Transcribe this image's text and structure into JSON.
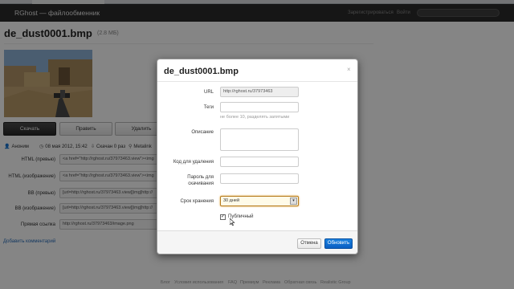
{
  "navbar": {
    "brand": "RGhost — файлообменник",
    "register": "Зарегистрироваться",
    "login": "Войти"
  },
  "file": {
    "title": "de_dust0001.bmp",
    "size": "(2.8 МБ)",
    "buttons": {
      "download": "Скачать",
      "edit": "Править",
      "delete": "Удалить"
    },
    "meta": {
      "author": "Аноним",
      "date": "08 мая 2012, 15:42",
      "downloads": "Скачан 0 раз",
      "metalink": "Metalink"
    },
    "rows": [
      {
        "label": "HTML (превью)",
        "value": "<a href=\"http://rghost.ru/37973463.view\"><img"
      },
      {
        "label": "HTML (изображение)",
        "value": "<a href=\"http://rghost.ru/37973463.view\"><img"
      },
      {
        "label": "BB (превью)",
        "value": "[url=http://rghost.ru/37973463.view][img]http://"
      },
      {
        "label": "BB (изображение)",
        "value": "[url=http://rghost.ru/37973463.view][img]http://"
      },
      {
        "label": "Прямая ссылка",
        "value": "http://rghost.ru/37973463/image.png"
      }
    ],
    "add_comment": "Добавить комментарий"
  },
  "modal": {
    "title": "de_dust0001.bmp",
    "close": "×",
    "url_label": "URL",
    "url_value": "http://rghost.ru/37973463",
    "tags_label": "Теги",
    "tags_help": "не более 10, разделять запятыми",
    "description_label": "Описание",
    "delete_code_label": "Код для удаления",
    "password_label": "Пароль для скачивания",
    "retention_label": "Срок хранения",
    "retention_value": "30 дней",
    "public_label": "Публичный",
    "public_checked": true,
    "cancel": "Отмена",
    "update": "Обновить"
  },
  "footer": {
    "links": [
      "Блог",
      "Условия использования",
      "FAQ",
      "Премиум",
      "Реклама",
      "Обратная связь",
      "Realistic Group"
    ]
  }
}
